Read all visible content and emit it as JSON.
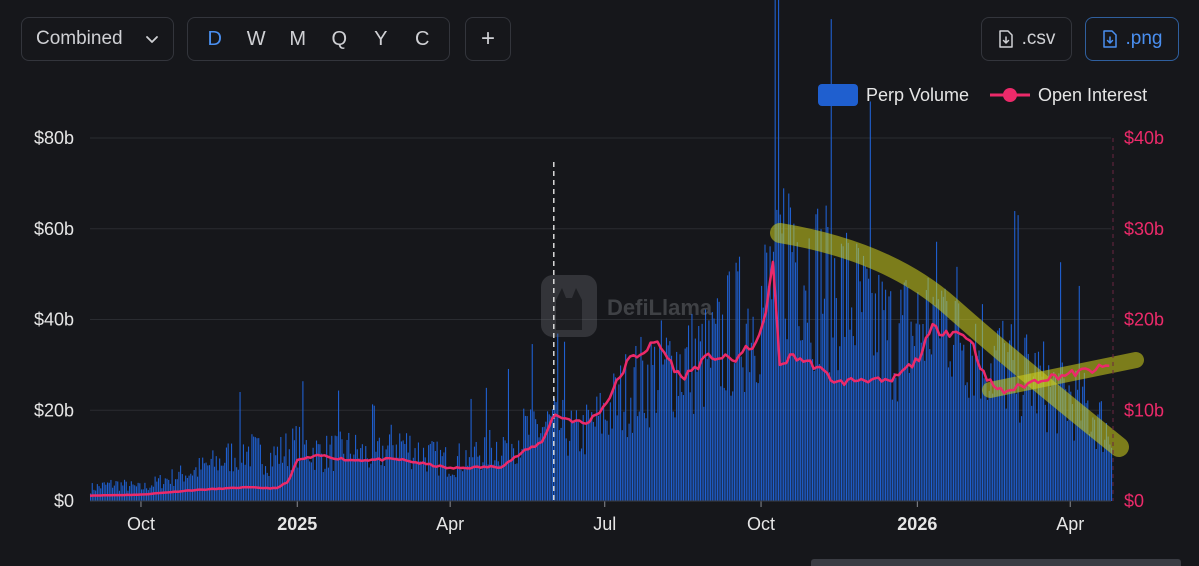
{
  "toolbar": {
    "select_label": "Combined",
    "periods": [
      "D",
      "W",
      "M",
      "Q",
      "Y",
      "C"
    ],
    "active_period": "D",
    "add_label": "+",
    "csv_label": ".csv",
    "png_label": ".png"
  },
  "watermark": "DefiLlama",
  "colors": {
    "volume": "#1f5fcf",
    "open_interest": "#ec2a6a",
    "annotation": "#d1d11c",
    "grid": "#2a2c31",
    "accent": "#4a8ff0"
  },
  "chart_data": {
    "type": "bar+line",
    "title": "",
    "legend": [
      "Perp Volume",
      "Open Interest"
    ],
    "legend_position": "top-right",
    "x_tick_labels": [
      "Oct",
      "2025",
      "Apr",
      "Jul",
      "Oct",
      "2026",
      "Apr"
    ],
    "x_tick_dates": [
      "2024-10-01",
      "2025-01-01",
      "2025-04-01",
      "2025-07-01",
      "2025-10-01",
      "2026-01-01",
      "2026-04-01"
    ],
    "x_range": [
      "2024-09-01",
      "2026-04-25"
    ],
    "left_axis": {
      "ticks": [
        "$0",
        "$20b",
        "$40b",
        "$60b",
        "$80b"
      ],
      "values": [
        0,
        20,
        40,
        60,
        80
      ],
      "range": [
        0,
        80
      ],
      "unit": "b USD"
    },
    "right_axis": {
      "ticks": [
        "$0",
        "$10b",
        "$20b",
        "$30b",
        "$40b"
      ],
      "values": [
        0,
        10,
        20,
        30,
        40
      ],
      "range": [
        0,
        40
      ],
      "unit": "b USD"
    },
    "grid": true,
    "marker_line_date": "2025-06-01",
    "series": [
      {
        "name": "Perp Volume",
        "kind": "bar",
        "axis": "left",
        "dates": [
          "2024-09-01",
          "2024-09-15",
          "2024-10-01",
          "2024-10-15",
          "2024-11-01",
          "2024-11-15",
          "2024-12-01",
          "2024-12-15",
          "2025-01-01",
          "2025-01-15",
          "2025-02-01",
          "2025-02-15",
          "2025-03-01",
          "2025-03-15",
          "2025-04-01",
          "2025-04-15",
          "2025-05-01",
          "2025-05-15",
          "2025-06-01",
          "2025-06-15",
          "2025-07-01",
          "2025-07-15",
          "2025-08-01",
          "2025-08-15",
          "2025-09-01",
          "2025-09-15",
          "2025-10-01",
          "2025-10-10",
          "2025-10-20",
          "2025-11-01",
          "2025-11-15",
          "2025-12-01",
          "2025-12-15",
          "2026-01-01",
          "2026-01-15",
          "2026-02-01",
          "2026-02-15",
          "2026-03-01",
          "2026-03-15",
          "2026-04-01",
          "2026-04-15",
          "2026-04-25"
        ],
        "values": [
          3,
          4,
          3,
          5,
          7,
          9,
          12,
          10,
          13,
          11,
          12,
          10,
          14,
          11,
          9,
          11,
          13,
          16,
          18,
          15,
          20,
          26,
          30,
          32,
          33,
          40,
          45,
          55,
          62,
          52,
          50,
          43,
          38,
          40,
          45,
          38,
          33,
          30,
          27,
          24,
          20,
          15
        ]
      },
      {
        "name": "Open Interest",
        "kind": "line",
        "axis": "right",
        "dates": [
          "2024-09-01",
          "2024-10-01",
          "2024-11-01",
          "2024-12-01",
          "2024-12-20",
          "2024-12-27",
          "2025-01-01",
          "2025-01-15",
          "2025-02-01",
          "2025-03-01",
          "2025-04-01",
          "2025-05-01",
          "2025-05-15",
          "2025-05-25",
          "2025-06-01",
          "2025-06-10",
          "2025-06-20",
          "2025-07-01",
          "2025-07-15",
          "2025-08-01",
          "2025-08-15",
          "2025-09-01",
          "2025-09-15",
          "2025-10-01",
          "2025-10-08",
          "2025-10-12",
          "2025-10-20",
          "2025-11-01",
          "2025-11-15",
          "2025-12-01",
          "2025-12-15",
          "2026-01-01",
          "2026-01-10",
          "2026-01-25",
          "2026-02-01",
          "2026-02-10",
          "2026-02-20",
          "2026-03-01",
          "2026-03-15",
          "2026-04-01",
          "2026-04-15",
          "2026-04-25"
        ],
        "values": [
          0.6,
          0.7,
          1.2,
          1.5,
          1.4,
          2.2,
          4.5,
          5.0,
          4.5,
          4.6,
          3.6,
          3.8,
          5.5,
          6.5,
          9.5,
          9.0,
          8.5,
          10.5,
          15.5,
          17.5,
          13.5,
          16.0,
          15.5,
          18.0,
          26.0,
          15.0,
          16.0,
          15.0,
          13.0,
          13.5,
          13.0,
          15.5,
          19.0,
          18.5,
          18.0,
          13.5,
          12.0,
          12.5,
          13.5,
          14.0,
          14.5,
          14.8
        ]
      }
    ]
  }
}
